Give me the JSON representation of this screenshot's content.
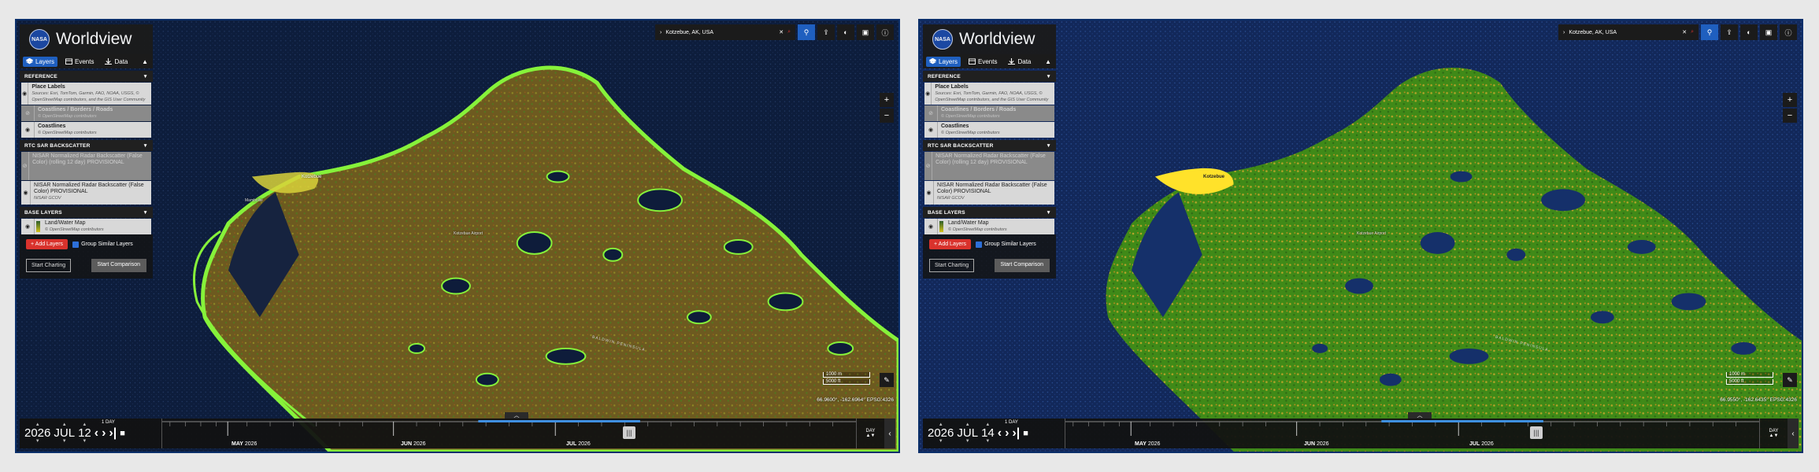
{
  "app": {
    "title": "Worldview",
    "logo_text": "NASA"
  },
  "tabs": [
    {
      "label": "Layers",
      "icon": "layers-icon"
    },
    {
      "label": "Events",
      "icon": "calendar-icon"
    },
    {
      "label": "Data",
      "icon": "download-icon"
    }
  ],
  "groups": {
    "reference": "REFERENCE",
    "rtc": "RTC SAR BACKSCATTER",
    "base": "BASE LAYERS"
  },
  "layers": {
    "place_labels": {
      "title": "Place Labels",
      "source": "Sources: Esri, TomTom, Garmin, FAO, NOAA, USGS, © OpenStreetMap contributors, and the GIS User Community"
    },
    "coastlines_borders": {
      "title": "Coastlines / Borders / Roads",
      "source": "© OpenStreetMap contributors"
    },
    "coastlines": {
      "title": "Coastlines",
      "source": "© OpenStreetMap contributors"
    },
    "nisar_rolling": {
      "title": "NISAR Normalized Radar Backscatter (False Color) (rolling 12 day) PROVISIONAL",
      "source": ""
    },
    "nisar": {
      "title": "NISAR Normalized Radar Backscatter (False Color) PROVISIONAL",
      "source": "NISAR GCOV"
    },
    "land_water": {
      "title": "Land/Water Map",
      "source": "© OpenStreetMap contributors"
    }
  },
  "buttons": {
    "add_layers": "+ Add Layers",
    "group_similar": "Group Similar Layers",
    "start_charting": "Start Charting",
    "start_comparison": "Start Comparison"
  },
  "search": {
    "value": "Kotzebue, AK, USA"
  },
  "map": {
    "city_label": "Kotzebue",
    "village_label": "Mambollie",
    "site_labels": [
      "Kotzebue Airport"
    ],
    "road_label": "BALDWIN PENINSULA"
  },
  "scale": {
    "metric": "1000 m",
    "imperial": "5000 ft"
  },
  "views": {
    "left": {
      "coords": "66.9600°, -162.6964° EPSG:4326",
      "date": {
        "year": "2026",
        "month": "JUL",
        "day": "12"
      }
    },
    "right": {
      "coords": "66.9550°, -162.6435° EPSG:4326",
      "date": {
        "year": "2026",
        "month": "JUL",
        "day": "14"
      }
    }
  },
  "timeline": {
    "interval": "1 DAY",
    "zoom_level": "DAY",
    "months": [
      {
        "name": "MAY",
        "year": "2026"
      },
      {
        "name": "JUN",
        "year": "2026"
      },
      {
        "name": "JUL",
        "year": "2026"
      }
    ]
  },
  "colors": {
    "left_land": "#6b5a1f",
    "left_vegetation": "#7fe23a",
    "right_land": "#3f8a18",
    "right_highlight": "#ffe22a",
    "water": "#0c1b3a",
    "accent": "#1f5fbf",
    "add_button": "#d9322c"
  }
}
